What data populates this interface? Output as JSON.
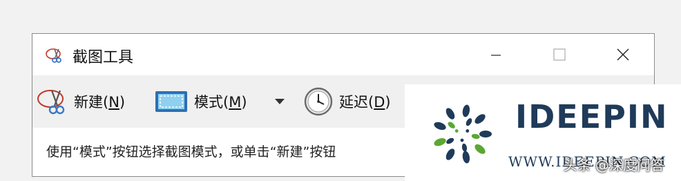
{
  "window": {
    "title": "截图工具",
    "controls": {
      "minimize": "minimize",
      "maximize": "maximize",
      "close": "close"
    }
  },
  "toolbar": {
    "new_label": "新建(",
    "new_key": "N",
    "new_suffix": ")",
    "mode_label": "模式(",
    "mode_key": "M",
    "mode_suffix": ")",
    "delay_label": "延迟(",
    "delay_key": "D",
    "delay_suffix": ")"
  },
  "status": {
    "text": "使用“模式”按钮选择截图模式，或单击“新建”按钮"
  },
  "watermark": {
    "brand": "IDEEPIN",
    "url": "WWW.IDEEPIN.COM",
    "credit": "头条 @深度问答"
  },
  "colors": {
    "brand_navy": "#1f3b59",
    "brand_green": "#5aa832",
    "toolbar_bg": "#f0f0f0"
  },
  "icons": {
    "title": "snipping-scissors-icon",
    "new": "snipping-scissors-icon",
    "mode": "screen-mode-icon",
    "dropdown": "dropdown-arrow-icon",
    "delay": "clock-icon"
  }
}
